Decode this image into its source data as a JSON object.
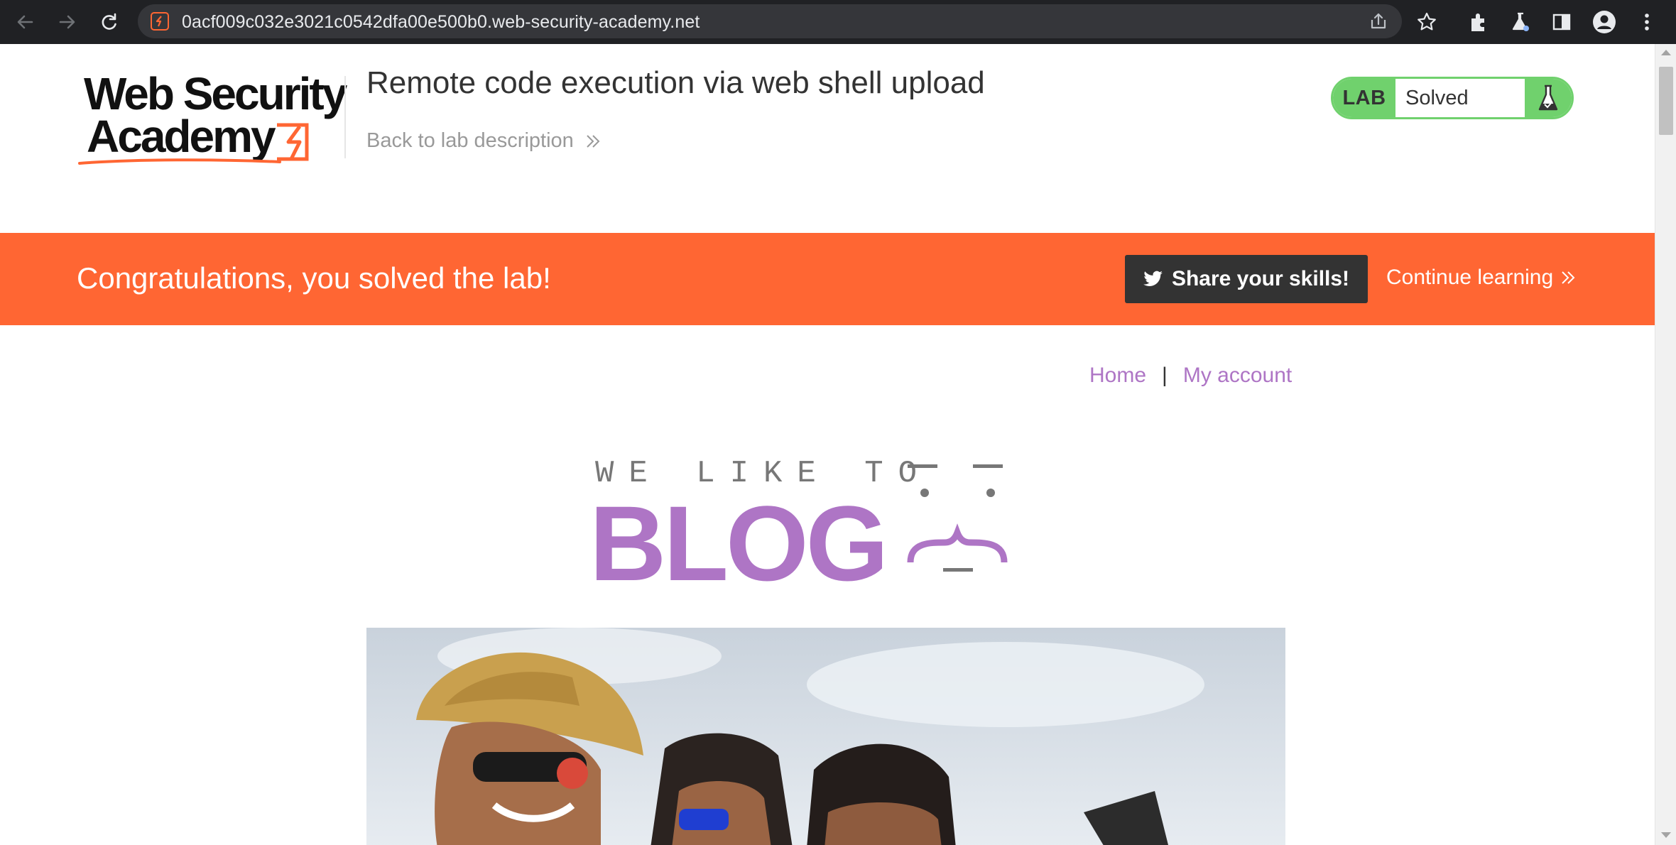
{
  "browser": {
    "url": "0acf009c032e3021c0542dfa00e500b0.web-security-academy.net",
    "icons": [
      "back-arrow-icon",
      "forward-arrow-icon",
      "reload-icon",
      "share-icon",
      "bookmark-star-icon",
      "extensions-puzzle-icon",
      "labs-flask-icon",
      "side-panel-icon",
      "profile-avatar-icon",
      "menu-kebab-icon"
    ]
  },
  "header": {
    "logo_line1": "Web Security",
    "logo_line2": "Academy",
    "lab_title": "Remote code execution via web shell upload",
    "back_link": "Back to lab description",
    "lab_status": {
      "tag": "LAB",
      "value": "Solved"
    }
  },
  "banner": {
    "message": "Congratulations, you solved the lab!",
    "share_button": "Share your skills!",
    "continue_link": "Continue learning"
  },
  "nav": {
    "home": "Home",
    "separator": "|",
    "my_account": "My account"
  },
  "blog_logo": {
    "tagline": "WE LIKE TO",
    "word": "BLOG"
  },
  "colors": {
    "accent_orange": "#ff6633",
    "lab_green": "#70d16d",
    "blog_purple": "#ae75c5",
    "dark": "#333333"
  }
}
